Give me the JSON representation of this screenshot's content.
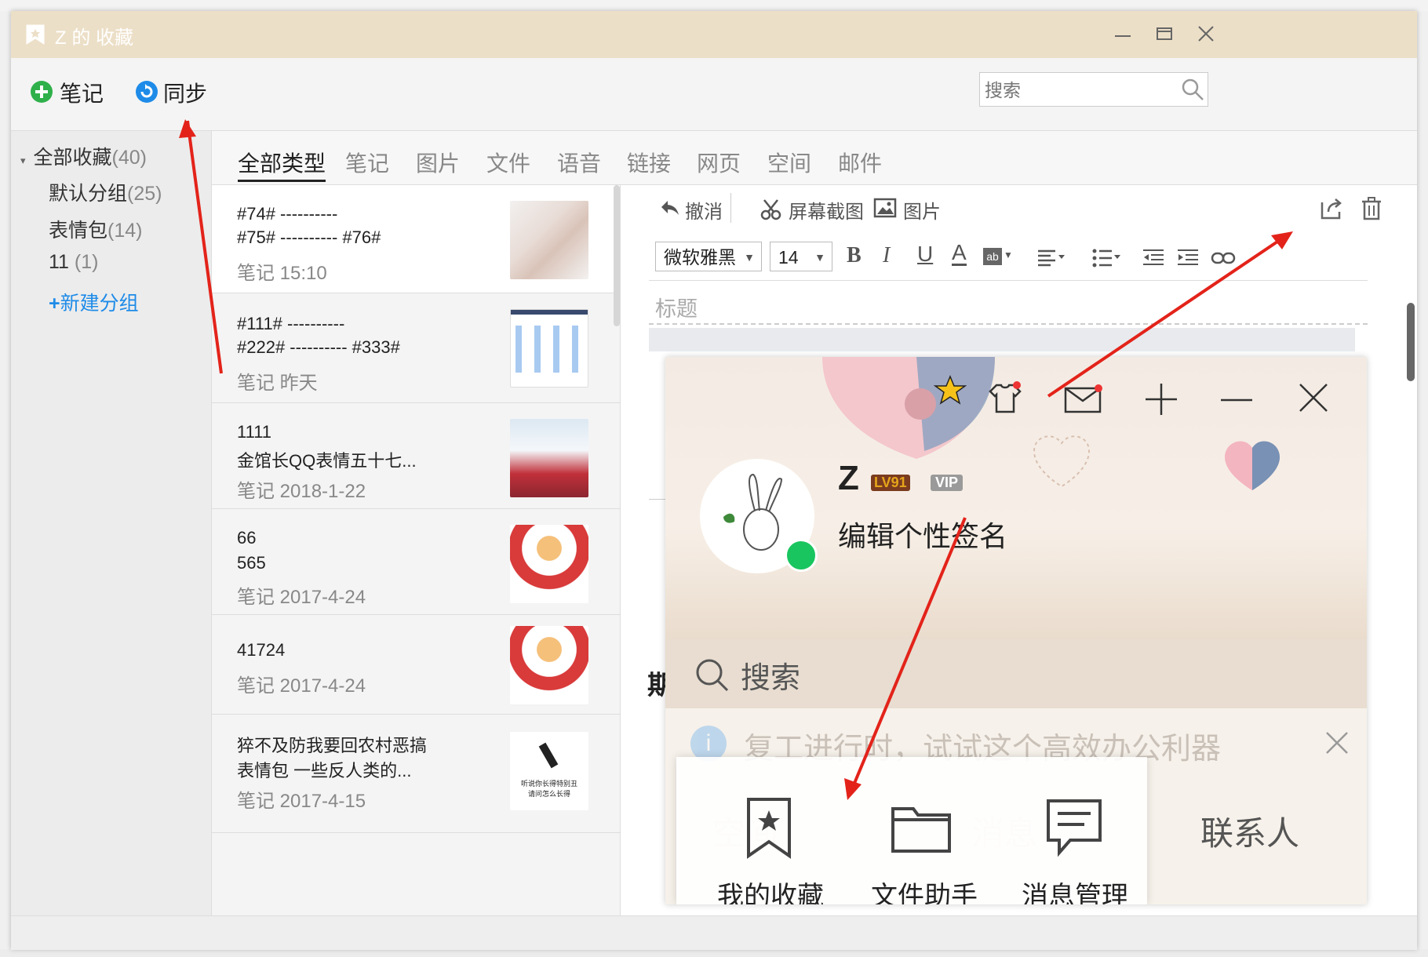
{
  "window": {
    "title": "Z 的 收藏"
  },
  "toolbar": {
    "note_label": "笔记",
    "sync_label": "同步",
    "search_placeholder": "搜索"
  },
  "sidebar": {
    "root": {
      "label": "全部收藏",
      "count": "(40)"
    },
    "groups": [
      {
        "label": "默认分组",
        "count": "(25)"
      },
      {
        "label": "表情包",
        "count": "(14)"
      },
      {
        "label": "11",
        "count": "(1)"
      }
    ],
    "new_group": "新建分组"
  },
  "type_tabs": [
    "全部类型",
    "笔记",
    "图片",
    "文件",
    "语音",
    "链接",
    "网页",
    "空间",
    "邮件"
  ],
  "items": [
    {
      "lines": [
        "#74# ----------",
        "#75# ---------- #76#"
      ],
      "meta": "笔记 15:10"
    },
    {
      "lines": [
        "#111#  ----------",
        "#222#  ---------- #333#"
      ],
      "meta": "笔记 昨天"
    },
    {
      "lines": [
        "1111",
        "金馆长QQ表情五十七..."
      ],
      "meta": "笔记 2018-1-22"
    },
    {
      "lines": [
        "66",
        "565"
      ],
      "meta": "笔记 2017-4-24"
    },
    {
      "lines": [
        "41724"
      ],
      "meta": "笔记 2017-4-24"
    },
    {
      "lines": [
        "猝不及防我要回农村恶搞",
        "表情包 一些反人类的..."
      ],
      "meta": "笔记 2017-4-15"
    }
  ],
  "thumb6_caption": [
    "听说你长得特别丑",
    "请问怎么长得"
  ],
  "editor": {
    "undo_label": "撤消",
    "screenshot_label": "屏幕截图",
    "image_label": "图片",
    "font_name": "微软雅黑",
    "font_size": "14",
    "title_placeholder": "标题"
  },
  "popup": {
    "username": "Z",
    "level_badge": "LV91",
    "vip_badge": "VIP",
    "signature": "编辑个性签名",
    "search_label": "搜索",
    "notice": "复工进行时，试试这个高效办公利器",
    "tabs_behind": [
      "空间",
      "消息",
      "联系人"
    ],
    "menu": [
      "我的收藏",
      "文件助手",
      "消息管理"
    ],
    "left_fragment": "期"
  },
  "colors": {
    "titlebar": "#ecdfc7",
    "accent_blue": "#1e8be8",
    "green": "#2fb04a",
    "arrow_red": "#e3231a",
    "online": "#19c55e"
  }
}
